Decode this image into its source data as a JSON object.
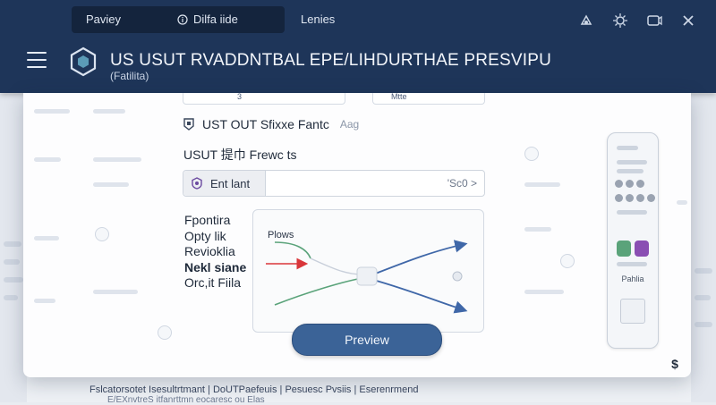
{
  "topbar": {
    "tabs": [
      "Paviey",
      "Dilfa iide",
      "Lenies"
    ],
    "title": "US USUT RVADDNTBAL EPE/LIHDURTHAE PRESVIPU",
    "subtitle": "(Fatilita)",
    "icons": [
      "share-icon",
      "brightness-icon",
      "window-icon",
      "close-icon"
    ]
  },
  "dialog": {
    "faint_fields": [
      "3",
      "Mtte"
    ],
    "option_line": {
      "label": "UST OUT Sfixxe Fantc",
      "hint": "Aag"
    },
    "section_label": "USUT 提巾 Frewc ts",
    "field": {
      "value": "Ent lant",
      "right_text": "'Sc0 >"
    },
    "options": [
      "Fpontira",
      "Opty lik",
      "Revioklia",
      "Nekl siane",
      "Orc,it Fiila"
    ],
    "bold_option_index": 3,
    "preview": {
      "label": "Plows",
      "button": "Preview",
      "colors": {
        "green": "#5aa37a",
        "red": "#d9363a",
        "blue": "#3f67a8"
      }
    },
    "device_panel": {
      "label": "Pahlia"
    },
    "dollar_icon": "$"
  },
  "background": {
    "footer_line1": "Fslcatorsotet Isesultrtmant | DoUTPaefeuis | Pesuesc Pvsiis | Eserenrmend",
    "footer_line2": "E/EXnvtreS itfanrttmn eocaresc ou Elas"
  }
}
